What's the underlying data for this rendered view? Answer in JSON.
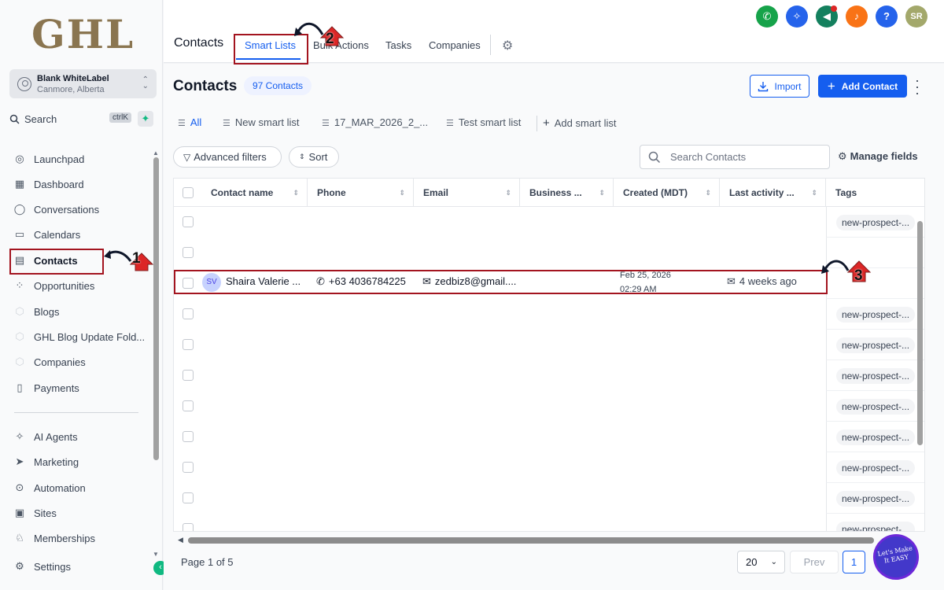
{
  "sidebar": {
    "logo": "GHL",
    "account_name": "Blank WhiteLabel",
    "account_location": "Canmore, Alberta",
    "search_label": "Search",
    "search_shortcut": "ctrlK",
    "items": [
      {
        "label": "Launchpad",
        "icon": "rocket-icon"
      },
      {
        "label": "Dashboard",
        "icon": "grid-icon"
      },
      {
        "label": "Conversations",
        "icon": "chat-icon"
      },
      {
        "label": "Calendars",
        "icon": "calendar-icon"
      },
      {
        "label": "Contacts",
        "icon": "contact-book-icon"
      },
      {
        "label": "Opportunities",
        "icon": "opportunities-icon"
      },
      {
        "label": "Blogs",
        "icon": "cube-icon"
      },
      {
        "label": "GHL Blog Update Fold...",
        "icon": "cube-icon"
      },
      {
        "label": "Companies",
        "icon": "cube-icon"
      },
      {
        "label": "Payments",
        "icon": "receipt-icon"
      },
      {
        "label": "AI Agents",
        "icon": "sparkles-icon"
      },
      {
        "label": "Marketing",
        "icon": "send-icon"
      },
      {
        "label": "Automation",
        "icon": "automation-icon"
      },
      {
        "label": "Sites",
        "icon": "sites-icon"
      },
      {
        "label": "Memberships",
        "icon": "memberships-icon"
      },
      {
        "label": "Settings",
        "icon": "gear-icon"
      }
    ]
  },
  "topbar": {
    "title": "Contacts",
    "tabs": [
      "Smart Lists",
      "Bulk Actions",
      "Tasks",
      "Companies"
    ],
    "avatar_initials": "SR",
    "icon_colors": {
      "phone": "#16a34a",
      "ai": "#2563eb",
      "announce": "#14805e",
      "bell": "#f97316",
      "help": "#2563eb",
      "avatar": "#a3a86b"
    }
  },
  "main": {
    "title": "Contacts",
    "count": "97 Contacts",
    "import_label": "Import",
    "add_label": "Add Contact",
    "list_tabs": [
      "All",
      "New smart list",
      "17_MAR_2026_2_...",
      "Test smart list",
      "Add smart list"
    ],
    "advanced_filters": "Advanced filters",
    "sort": "Sort",
    "search_placeholder": "Search Contacts",
    "manage_fields": "Manage fields",
    "columns": [
      "Contact name",
      "Phone",
      "Email",
      "Business ...",
      "Created (MDT)",
      "Last activity ...",
      "Tags"
    ],
    "highlight_row": {
      "initials": "SV",
      "name": "Shaira Valerie ...",
      "phone": "+63 4036784225",
      "email": "zedbiz8@gmail....",
      "created_date": "Feb 25, 2026",
      "created_time": "02:29 AM",
      "last_activity": "4 weeks ago"
    },
    "tag_label": "new-prospect-...",
    "page_info": "Page 1 of 5",
    "per_page": "20",
    "prev": "Prev",
    "page_number": "1",
    "badge_text": "Let's Make It EASY"
  },
  "annotations": {
    "one": "1",
    "two": "2",
    "three": "3"
  }
}
